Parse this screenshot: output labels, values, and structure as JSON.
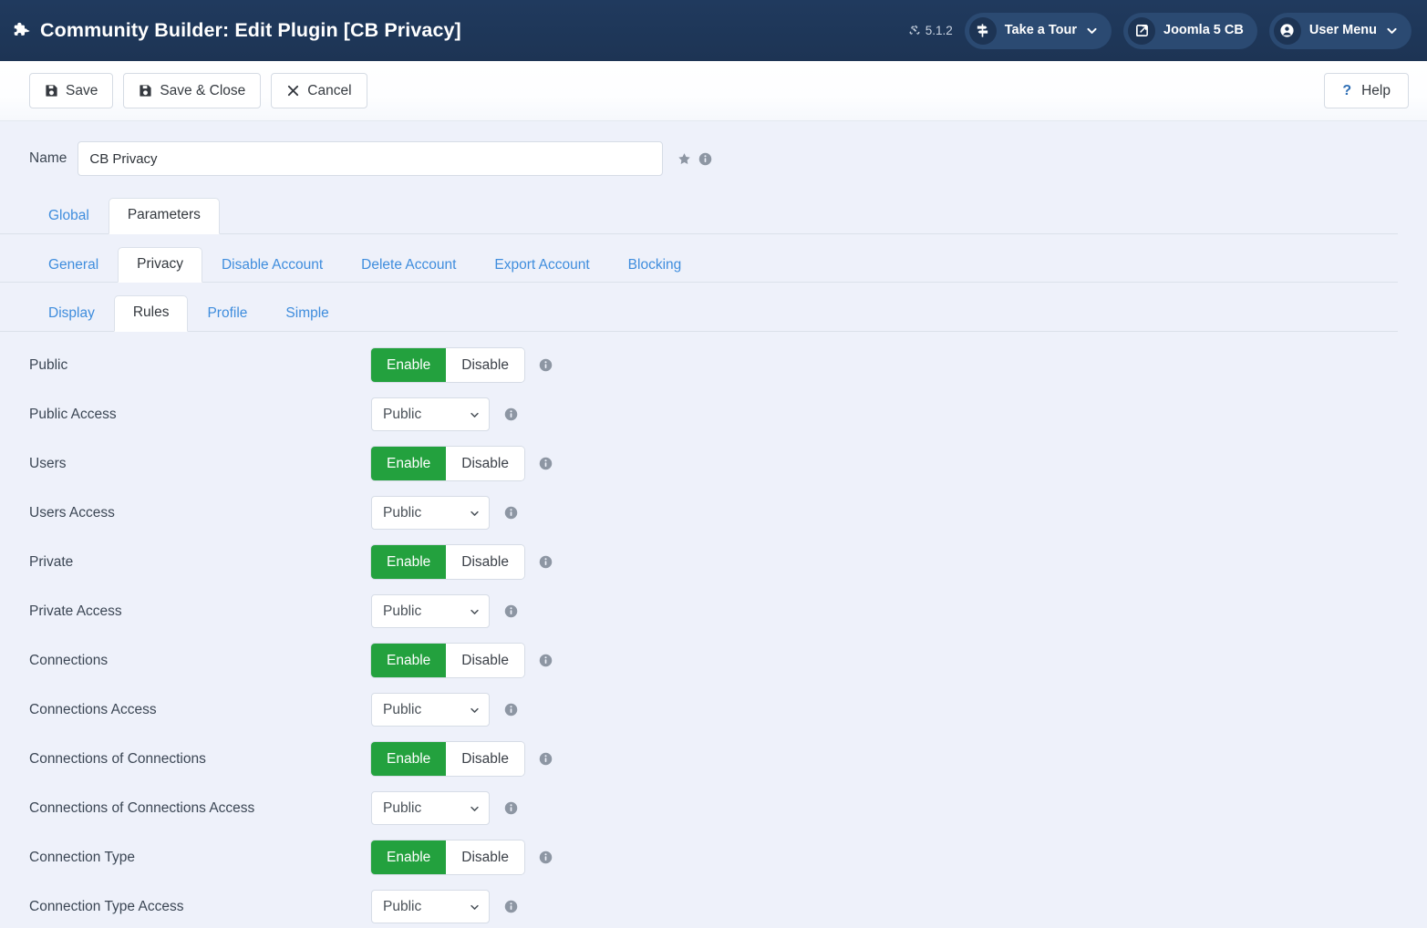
{
  "header": {
    "title": "Community Builder: Edit Plugin [CB Privacy]",
    "title_icon": "puzzle-piece-icon",
    "version_label": "5.1.2",
    "version_icon": "joomla-logo-icon",
    "tour_button": {
      "label": "Take a Tour",
      "icon": "signpost-icon",
      "chevron": "chevron-down-icon"
    },
    "site_button": {
      "label": "Joomla 5 CB",
      "icon": "external-link-icon"
    },
    "user_menu": {
      "label": "User Menu",
      "icon": "user-circle-icon",
      "chevron": "chevron-down-icon"
    }
  },
  "toolbar": {
    "save_label": "Save",
    "save_icon": "floppy-disk-icon",
    "save_close_label": "Save & Close",
    "save_close_icon": "floppy-disk-icon",
    "cancel_label": "Cancel",
    "cancel_icon": "close-x-icon",
    "help_label": "Help",
    "help_icon": "question-mark-icon"
  },
  "name_field": {
    "label": "Name",
    "value": "CB Privacy",
    "placeholder": "",
    "star_icon": "star-icon",
    "info_icon": "info-circle-icon"
  },
  "tabs_level1": [
    {
      "label": "Global",
      "active": false
    },
    {
      "label": "Parameters",
      "active": true
    }
  ],
  "tabs_level2": [
    {
      "label": "General",
      "active": false
    },
    {
      "label": "Privacy",
      "active": true
    },
    {
      "label": "Disable Account",
      "active": false
    },
    {
      "label": "Delete Account",
      "active": false
    },
    {
      "label": "Export Account",
      "active": false
    },
    {
      "label": "Blocking",
      "active": false
    }
  ],
  "tabs_level3": [
    {
      "label": "Display",
      "active": false
    },
    {
      "label": "Rules",
      "active": true
    },
    {
      "label": "Profile",
      "active": false
    },
    {
      "label": "Simple",
      "active": false
    }
  ],
  "toggle_labels": {
    "enable": "Enable",
    "disable": "Disable"
  },
  "select_options": [
    "Public"
  ],
  "info_icon": "info-circle-icon",
  "rows": [
    {
      "label": "Public",
      "type": "toggle",
      "value": "Enable"
    },
    {
      "label": "Public Access",
      "type": "select",
      "value": "Public"
    },
    {
      "label": "Users",
      "type": "toggle",
      "value": "Enable"
    },
    {
      "label": "Users Access",
      "type": "select",
      "value": "Public"
    },
    {
      "label": "Private",
      "type": "toggle",
      "value": "Enable"
    },
    {
      "label": "Private Access",
      "type": "select",
      "value": "Public"
    },
    {
      "label": "Connections",
      "type": "toggle",
      "value": "Enable"
    },
    {
      "label": "Connections Access",
      "type": "select",
      "value": "Public"
    },
    {
      "label": "Connections of Connections",
      "type": "toggle",
      "value": "Enable"
    },
    {
      "label": "Connections of Connections Access",
      "type": "select",
      "value": "Public"
    },
    {
      "label": "Connection Type",
      "type": "toggle",
      "value": "Enable"
    },
    {
      "label": "Connection Type Access",
      "type": "select",
      "value": "Public"
    }
  ],
  "colors": {
    "header_bg": "#1f3a5f",
    "page_bg": "#eef1fa",
    "accent_green": "#23a13e",
    "link_blue": "#3f8ddd"
  }
}
